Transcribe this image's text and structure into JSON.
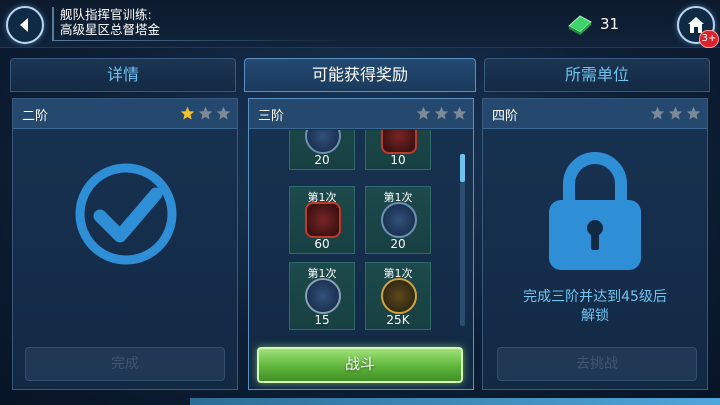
{
  "header": {
    "title_line1": "舰队指挥官训练:",
    "title_line2": "高级星区总督塔金",
    "currency_value": "31",
    "notification_count": "3+"
  },
  "tabs": [
    {
      "label": "详情",
      "active": false
    },
    {
      "label": "可能获得奖励",
      "active": true
    },
    {
      "label": "所需单位",
      "active": false
    }
  ],
  "panels": {
    "left": {
      "title": "二阶",
      "stars_filled": 1,
      "stars_total": 3,
      "status_icon": "check-icon",
      "button_label": "完成"
    },
    "middle": {
      "title": "三阶",
      "stars_filled": 0,
      "stars_total": 3,
      "rewards": [
        {
          "tag": "",
          "qty": "20",
          "icon": "character-portrait-icon"
        },
        {
          "tag": "",
          "qty": "10",
          "icon": "ship-icon"
        },
        {
          "tag": "第1次",
          "qty": "60",
          "icon": "character-shard-icon"
        },
        {
          "tag": "第1次",
          "qty": "20",
          "icon": "character-portrait-icon"
        },
        {
          "tag": "第1次",
          "qty": "15",
          "icon": "gear-part-icon"
        },
        {
          "tag": "第1次",
          "qty": "25K",
          "icon": "credits-icon"
        }
      ],
      "battle_label": "战斗"
    },
    "right": {
      "title": "四阶",
      "stars_filled": 0,
      "stars_total": 3,
      "status_icon": "lock-icon",
      "unlock_text_1": "完成三阶并达到45级后",
      "unlock_text_2": "解锁",
      "button_label": "去挑战"
    }
  },
  "colors": {
    "accent": "#6fc3f0",
    "star_gold": "#f2c12e",
    "star_gray": "#7d8a98",
    "battle_green": "#5fb53a"
  }
}
